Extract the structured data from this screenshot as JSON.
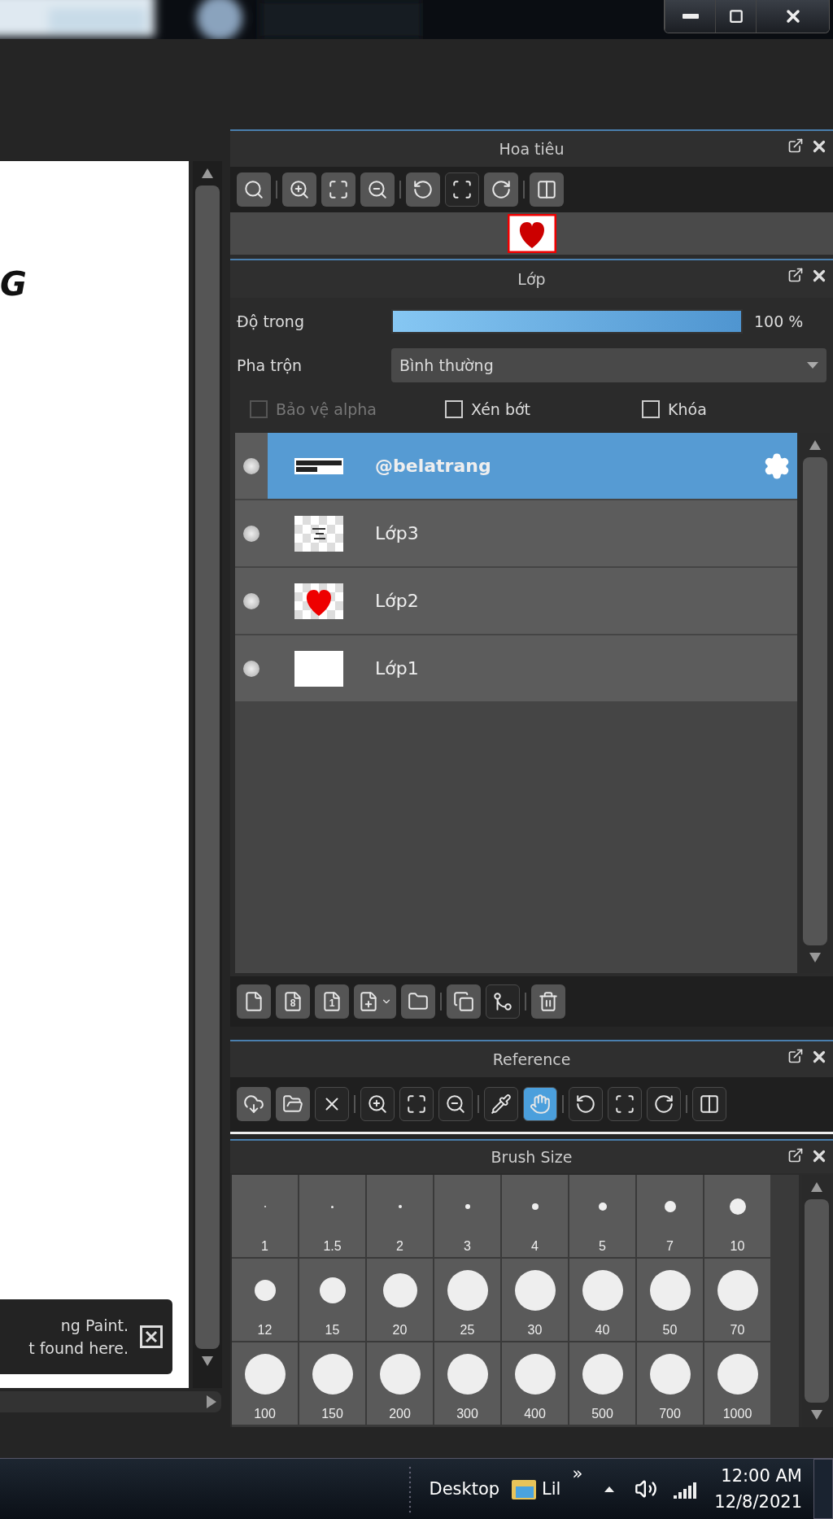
{
  "canvas": {
    "text": "G",
    "notification": {
      "lines": [
        "ng Paint.",
        "t found here."
      ]
    }
  },
  "navigator": {
    "title": "Hoa tiêu",
    "tools": [
      {
        "kind": "zoom-actual",
        "flat": false,
        "selected": false
      },
      {
        "kind": "separator"
      },
      {
        "kind": "zoom-in",
        "flat": false,
        "selected": false
      },
      {
        "kind": "fit",
        "flat": false,
        "selected": false
      },
      {
        "kind": "zoom-out",
        "flat": false,
        "selected": false
      },
      {
        "kind": "separator"
      },
      {
        "kind": "rotate-left",
        "flat": false,
        "selected": false
      },
      {
        "kind": "reset",
        "flat": true,
        "selected": false
      },
      {
        "kind": "rotate-right",
        "flat": false,
        "selected": false
      },
      {
        "kind": "separator"
      },
      {
        "kind": "flip",
        "flat": false,
        "selected": false
      }
    ]
  },
  "layers": {
    "title": "Lớp",
    "opacity": {
      "label": "Độ trong",
      "level": 1,
      "reading": "100 %"
    },
    "blend": {
      "label": "Pha trộn",
      "value": "Bình thường"
    },
    "options": [
      {
        "label": "Bảo vệ alpha",
        "checked": false,
        "disabled": true
      },
      {
        "label": "Xén bớt",
        "checked": false,
        "disabled": false
      },
      {
        "label": "Khóa",
        "checked": false,
        "disabled": false
      }
    ],
    "items": [
      {
        "name": "@belatrang",
        "selected": true,
        "kind": "text"
      },
      {
        "name": "Lớp3",
        "selected": false,
        "kind": "sketch"
      },
      {
        "name": "Lớp2",
        "selected": false,
        "kind": "heart"
      },
      {
        "name": "Lớp1",
        "selected": false,
        "kind": "blank"
      }
    ],
    "tools": [
      {
        "kind": "new",
        "flat": false
      },
      {
        "kind": "new-glyph",
        "glyph": "8",
        "flat": false
      },
      {
        "kind": "new-glyph",
        "glyph": "1",
        "flat": false
      },
      {
        "kind": "add-menu",
        "flat": false
      },
      {
        "kind": "folder",
        "flat": false
      },
      {
        "kind": "separator"
      },
      {
        "kind": "duplicate",
        "flat": false
      },
      {
        "kind": "merge",
        "flat": true
      },
      {
        "kind": "separator"
      },
      {
        "kind": "delete",
        "flat": false
      }
    ]
  },
  "reference": {
    "title": "Reference",
    "tools": [
      {
        "kind": "load",
        "flat": false,
        "selected": false
      },
      {
        "kind": "open",
        "flat": false,
        "selected": false
      },
      {
        "kind": "close",
        "flat": true,
        "selected": false
      },
      {
        "kind": "separator"
      },
      {
        "kind": "zoom-in",
        "flat": true,
        "selected": false
      },
      {
        "kind": "fit",
        "flat": true,
        "selected": false
      },
      {
        "kind": "zoom-out",
        "flat": true,
        "selected": false
      },
      {
        "kind": "separator"
      },
      {
        "kind": "pipette",
        "flat": true,
        "selected": false
      },
      {
        "kind": "hand",
        "flat": true,
        "selected": true
      },
      {
        "kind": "separator"
      },
      {
        "kind": "rotate-left",
        "flat": true,
        "selected": false
      },
      {
        "kind": "reset",
        "flat": true,
        "selected": false
      },
      {
        "kind": "rotate-right",
        "flat": true,
        "selected": false
      },
      {
        "kind": "separator"
      },
      {
        "kind": "flip",
        "flat": true,
        "selected": false
      }
    ]
  },
  "brush_size": {
    "title": "Brush Size",
    "sizes": [
      {
        "label": "1",
        "selected": false
      },
      {
        "label": "1.5",
        "selected": false
      },
      {
        "label": "2",
        "selected": false
      },
      {
        "label": "3",
        "selected": false
      },
      {
        "label": "4",
        "selected": false
      },
      {
        "label": "5",
        "selected": false
      },
      {
        "label": "7",
        "selected": false
      },
      {
        "label": "10",
        "selected": false
      },
      {
        "label": "12",
        "selected": false
      },
      {
        "label": "15",
        "selected": false
      },
      {
        "label": "20",
        "selected": false
      },
      {
        "label": "25",
        "selected": false
      },
      {
        "label": "30",
        "selected": false
      },
      {
        "label": "40",
        "selected": false
      },
      {
        "label": "50",
        "selected": false
      },
      {
        "label": "70",
        "selected": false
      },
      {
        "label": "100",
        "selected": false
      },
      {
        "label": "150",
        "selected": false
      },
      {
        "label": "200",
        "selected": false
      },
      {
        "label": "300",
        "selected": false
      },
      {
        "label": "400",
        "selected": false
      },
      {
        "label": "500",
        "selected": false
      },
      {
        "label": "700",
        "selected": false
      },
      {
        "label": "1000",
        "selected": false
      }
    ]
  },
  "taskbar": {
    "items": [
      {
        "label": "Desktop",
        "kind": "text"
      },
      {
        "label": "Lil",
        "kind": "folder"
      }
    ],
    "overflow": "»",
    "time": "12:00 AM",
    "date": "12/8/2021"
  }
}
